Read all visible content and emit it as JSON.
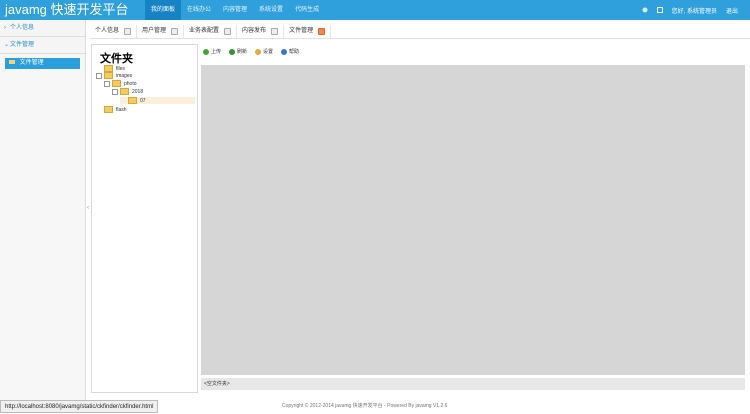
{
  "brand": "javamg 快速开发平台",
  "nav": [
    "我的面板",
    "在线办公",
    "内容管理",
    "系统设置",
    "代码生成"
  ],
  "top_right": {
    "user_label": "您好, 系统管理员",
    "logout_label": "退出"
  },
  "sidebar": {
    "groups": [
      "个人信息",
      "文件管理"
    ],
    "active_item": "文件管理"
  },
  "tabs": [
    {
      "label": "个人信息",
      "active": false
    },
    {
      "label": "用户管理",
      "active": false
    },
    {
      "label": "业务表配置",
      "active": false
    },
    {
      "label": "内容发布",
      "active": false
    },
    {
      "label": "文件管理",
      "active": true
    }
  ],
  "folders": {
    "title": "文件夹",
    "tree": [
      {
        "label": "files",
        "level": 0,
        "toggle": false,
        "selected": false
      },
      {
        "label": "images",
        "level": 0,
        "toggle": true,
        "selected": false
      },
      {
        "label": "photo",
        "level": 1,
        "toggle": true,
        "selected": false
      },
      {
        "label": "2018",
        "level": 2,
        "toggle": true,
        "selected": false
      },
      {
        "label": "07",
        "level": 3,
        "toggle": false,
        "selected": true
      },
      {
        "label": "flash",
        "level": 0,
        "toggle": false,
        "selected": false
      }
    ]
  },
  "toolbar": [
    {
      "label": "上传",
      "icon": "upload-icon",
      "color": "#48a23d"
    },
    {
      "label": "刷新",
      "icon": "refresh-icon",
      "color": "#3a8f2e"
    },
    {
      "label": "设置",
      "icon": "settings-icon",
      "color": "#e0b040"
    },
    {
      "label": "帮助",
      "icon": "help-icon",
      "color": "#3a77c8"
    }
  ],
  "status_text": "<空文件夹>",
  "url": "http://localhost:8080/javamg/static/ckfinder/ckfinder.html",
  "copyright": "Copyright © 2012-2014 javamg 快速开发平台 - Powered By javamg V1.2.6",
  "colors": {
    "accent": "#2fa0dc",
    "accent_dark": "#1583c4"
  }
}
